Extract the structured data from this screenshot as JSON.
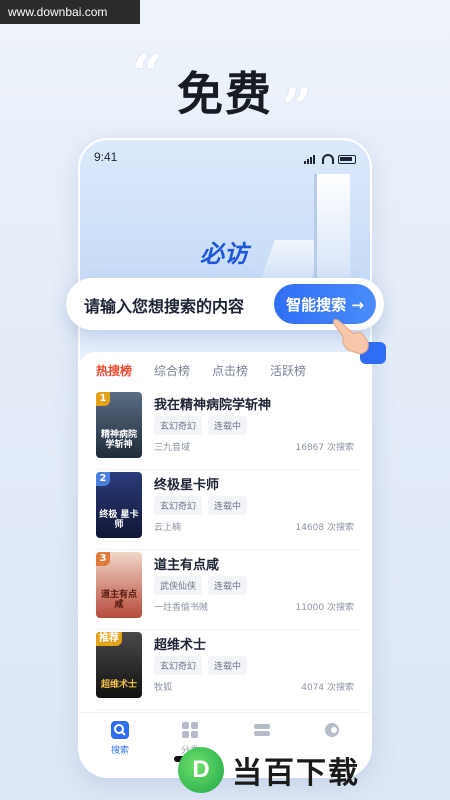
{
  "watermark_top": "www.downbai.com",
  "headline": {
    "quote_open": "“",
    "text": "免费",
    "quote_close": "”"
  },
  "phone": {
    "status_time": "9:41",
    "brand": "必访",
    "search": {
      "placeholder": "请输入您想搜索的内容",
      "button_label": "智能搜索 →"
    },
    "tabs": [
      "热搜榜",
      "综合榜",
      "点击榜",
      "活跃榜"
    ],
    "active_tab": "热搜榜",
    "items": [
      {
        "rank": "1",
        "title": "我在精神病院学斩神",
        "cover_text": "精神病院 学斩神",
        "tags": [
          "玄幻奇幻",
          "连载中"
        ],
        "author": "三九音域",
        "count": "16867 次搜索",
        "rank_color": "#e3a21a",
        "cover_color": "#3a4a5c"
      },
      {
        "rank": "2",
        "title": "终极星卡师",
        "cover_text": "终极 星卡师",
        "tags": [
          "玄幻奇幻",
          "连载中"
        ],
        "author": "云上楠",
        "count": "14608 次搜索",
        "rank_color": "#4a7fe0",
        "cover_color": "#1e2a5e"
      },
      {
        "rank": "3",
        "title": "道主有点咸",
        "cover_text": "道主有点咸",
        "tags": [
          "武侠仙侠",
          "连载中"
        ],
        "author": "一炷香偷书贼",
        "count": "11000 次搜索",
        "rank_color": "#e07a3a",
        "cover_color": "#b84a3a"
      },
      {
        "rank": "推荐",
        "title": "超维术士",
        "cover_text": "超维术士",
        "tags": [
          "玄幻奇幻",
          "连载中"
        ],
        "author": "牧狐",
        "count": "4074 次搜索",
        "rank_color": "#e3a21a",
        "cover_color": "#2c2c2c"
      }
    ],
    "nav": [
      {
        "label": "搜索",
        "icon": "search-icon",
        "active": true
      },
      {
        "label": "分类",
        "icon": "grid-icon",
        "active": false
      },
      {
        "label": "",
        "icon": "shelf-icon",
        "active": false
      },
      {
        "label": "",
        "icon": "profile-icon",
        "active": false
      }
    ]
  },
  "watermark_bottom": {
    "logo_letter": "D",
    "text": "当百下载"
  }
}
